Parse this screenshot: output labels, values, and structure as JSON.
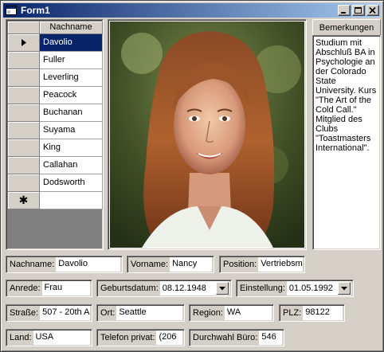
{
  "window": {
    "title": "Form1"
  },
  "grid": {
    "column_header": "Nachname",
    "rows": [
      "Davolio",
      "Fuller",
      "Leverling",
      "Peacock",
      "Buchanan",
      "Suyama",
      "King",
      "Callahan",
      "Dodsworth"
    ],
    "selected_index": 0,
    "new_row_marker": "✱"
  },
  "notes": {
    "header": "Bemerkungen",
    "text": "Studium mit Abschluß BA in Psychologie an der Colorado State University. Kurs \"The Art of the Cold Call.\" Mitglied des Clubs \"Toastmasters International\"."
  },
  "fields": {
    "nachname": {
      "label": "Nachname:",
      "value": "Davolio"
    },
    "vorname": {
      "label": "Vorname:",
      "value": "Nancy"
    },
    "position": {
      "label": "Position:",
      "value": "Vertriebsmi"
    },
    "anrede": {
      "label": "Anrede:",
      "value": "Frau"
    },
    "geburtsdatum": {
      "label": "Geburtsdatum:",
      "value": "08.12.1948"
    },
    "einstellung": {
      "label": "Einstellung:",
      "value": "01.05.1992"
    },
    "strasse": {
      "label": "Straße:",
      "value": "507 - 20th A"
    },
    "ort": {
      "label": "Ort:",
      "value": "Seattle"
    },
    "region": {
      "label": "Region:",
      "value": "WA"
    },
    "plz": {
      "label": "PLZ:",
      "value": "98122"
    },
    "land": {
      "label": "Land:",
      "value": "USA"
    },
    "telefon": {
      "label": "Telefon privat:",
      "value": "(206"
    },
    "durchwahl": {
      "label": "Durchwahl Büro:",
      "value": "546"
    }
  },
  "colors": {
    "selection": "#0a246a",
    "face": "#d4d0c8"
  }
}
